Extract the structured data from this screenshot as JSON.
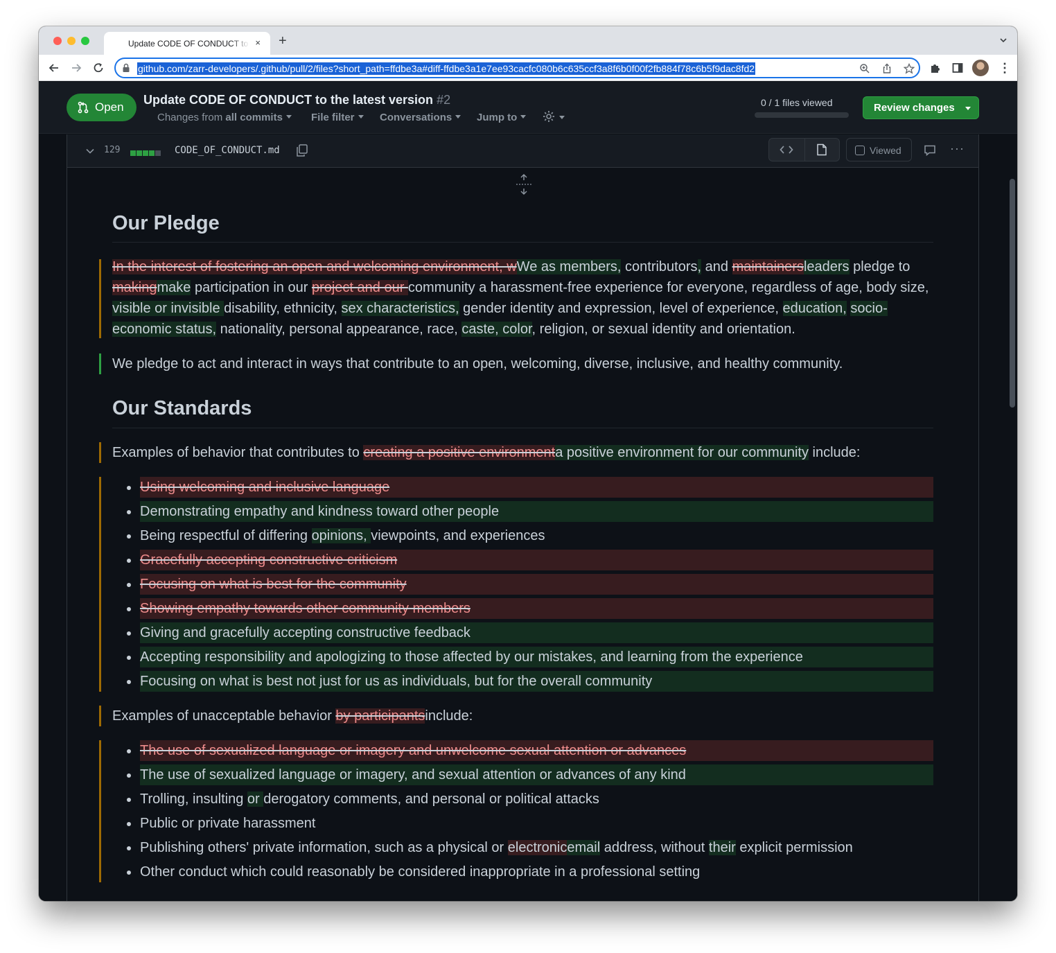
{
  "browser": {
    "tab_title": "Update CODE OF CONDUCT to the latest version",
    "tab_close": "×",
    "new_tab": "+",
    "url": "github.com/zarr-developers/.github/pull/2/files?short_path=ffdbe3a#diff-ffdbe3a1e7ee93cacfc080b6c635ccf3a8f6b0f00f2fb884f78c6b5f9dac8fd2",
    "menu": "⋮"
  },
  "pr": {
    "state_label": "Open",
    "title": "Update CODE OF CONDUCT to the latest version",
    "number": "#2",
    "tools": {
      "changes_prefix": "Changes from",
      "changes_value": "all commits",
      "file_filter": "File filter",
      "conversations": "Conversations",
      "jump_to": "Jump to"
    },
    "files_viewed": "0 / 1 files viewed",
    "files_viewed_fraction": 0,
    "review_button": "Review changes"
  },
  "file": {
    "changes_count": "129",
    "diffstat": [
      "add",
      "add",
      "add",
      "add",
      "neutral"
    ],
    "name": "CODE_OF_CONDUCT.md",
    "viewed_label": "Viewed",
    "more": "···",
    "colors": {
      "added": "#2ea043",
      "deleted": "#f85149",
      "changed": "#9e6a03"
    }
  },
  "doc": {
    "h_pledge": "Our Pledge",
    "pledge_p1": [
      {
        "t": "In the interest of fostering an open and welcoming environment, w",
        "k": "del"
      },
      {
        "t": "We as ",
        "k": "ins"
      },
      {
        "t": "members,",
        "k": "ins"
      },
      {
        "t": " contributors",
        "k": ""
      },
      {
        "t": ",",
        "k": "ins"
      },
      {
        "t": " and ",
        "k": ""
      },
      {
        "t": "maintainers",
        "k": "del"
      },
      {
        "t": "leaders",
        "k": "ins"
      },
      {
        "t": " pledge to ",
        "k": ""
      },
      {
        "t": "making",
        "k": "del"
      },
      {
        "t": "make",
        "k": "ins"
      },
      {
        "t": " participation in our ",
        "k": ""
      },
      {
        "t": "project and our ",
        "k": "del"
      },
      {
        "t": "community a harassment-free experience for everyone, regardless of age, body size, ",
        "k": ""
      },
      {
        "t": "visible or invisible ",
        "k": "ins"
      },
      {
        "t": "disability, ethnicity, ",
        "k": ""
      },
      {
        "t": "sex characteristics,",
        "k": "ins"
      },
      {
        "t": " gender identity and expression, level of experience, ",
        "k": ""
      },
      {
        "t": "education,",
        "k": "ins"
      },
      {
        "t": " ",
        "k": ""
      },
      {
        "t": "socio-economic status,",
        "k": "ins"
      },
      {
        "t": " nationality, personal appearance, race, ",
        "k": ""
      },
      {
        "t": "caste, color",
        "k": "ins"
      },
      {
        "t": ", religion, or sexual identity and orientation.",
        "k": ""
      }
    ],
    "pledge_p2": "We pledge to act and interact in ways that contribute to an open, welcoming, diverse, inclusive, and healthy community.",
    "h_standards": "Our Standards",
    "standards_intro": [
      {
        "t": "Examples of behavior that contributes to ",
        "k": ""
      },
      {
        "t": "creating a positive environment",
        "k": "del"
      },
      {
        "t": "a positive environment for our community",
        "k": "ins"
      },
      {
        "t": " include:",
        "k": ""
      }
    ],
    "positive_list": [
      {
        "k": "del",
        "parts": [
          {
            "t": "Using welcoming and inclusive language",
            "k": ""
          }
        ]
      },
      {
        "k": "add",
        "parts": [
          {
            "t": "Demonstrating empathy and kindness toward other people",
            "k": ""
          }
        ]
      },
      {
        "k": "",
        "parts": [
          {
            "t": "Being respectful of differing ",
            "k": ""
          },
          {
            "t": "opinions, ",
            "k": "ins"
          },
          {
            "t": "viewpoints, and experiences",
            "k": ""
          }
        ]
      },
      {
        "k": "del",
        "parts": [
          {
            "t": "Gracefully accepting constructive criticism",
            "k": ""
          }
        ]
      },
      {
        "k": "del",
        "parts": [
          {
            "t": "Focusing on what is best for the community",
            "k": ""
          }
        ]
      },
      {
        "k": "del",
        "parts": [
          {
            "t": "Showing empathy towards other community members",
            "k": ""
          }
        ]
      },
      {
        "k": "add",
        "parts": [
          {
            "t": "Giving and gracefully accepting constructive feedback",
            "k": ""
          }
        ]
      },
      {
        "k": "add",
        "parts": [
          {
            "t": "Accepting responsibility and apologizing to those affected by our mistakes, and learning from the experience",
            "k": ""
          }
        ]
      },
      {
        "k": "add",
        "parts": [
          {
            "t": "Focusing on what is best not just for us as individuals, but for the overall community",
            "k": ""
          }
        ]
      }
    ],
    "unacceptable_intro": [
      {
        "t": "Examples of unacceptable behavior ",
        "k": ""
      },
      {
        "t": "by participants",
        "k": "del"
      },
      {
        "t": "include:",
        "k": ""
      }
    ],
    "negative_list": [
      {
        "k": "del",
        "parts": [
          {
            "t": "The use of sexualized language or imagery and unwelcome sexual attention or advances",
            "k": ""
          }
        ]
      },
      {
        "k": "add",
        "parts": [
          {
            "t": "The use of sexualized language or imagery, and sexual attention or advances of any kind",
            "k": ""
          }
        ]
      },
      {
        "k": "",
        "parts": [
          {
            "t": "Trolling, insulting ",
            "k": ""
          },
          {
            "t": "or ",
            "k": "ins"
          },
          {
            "t": "derogatory comments, and personal or political attacks",
            "k": ""
          }
        ]
      },
      {
        "k": "",
        "parts": [
          {
            "t": "Public or private harassment",
            "k": ""
          }
        ]
      },
      {
        "k": "",
        "parts": [
          {
            "t": "Publishing others' private information, such as a physical or ",
            "k": ""
          },
          {
            "t": "electronic",
            "k": "delplain"
          },
          {
            "t": "email",
            "k": "ins"
          },
          {
            "t": " address, without ",
            "k": ""
          },
          {
            "t": "their",
            "k": "ins"
          },
          {
            "t": " explicit permission",
            "k": ""
          }
        ]
      },
      {
        "k": "",
        "parts": [
          {
            "t": "Other conduct which could reasonably be considered inappropriate in a professional setting",
            "k": ""
          }
        ]
      }
    ]
  }
}
